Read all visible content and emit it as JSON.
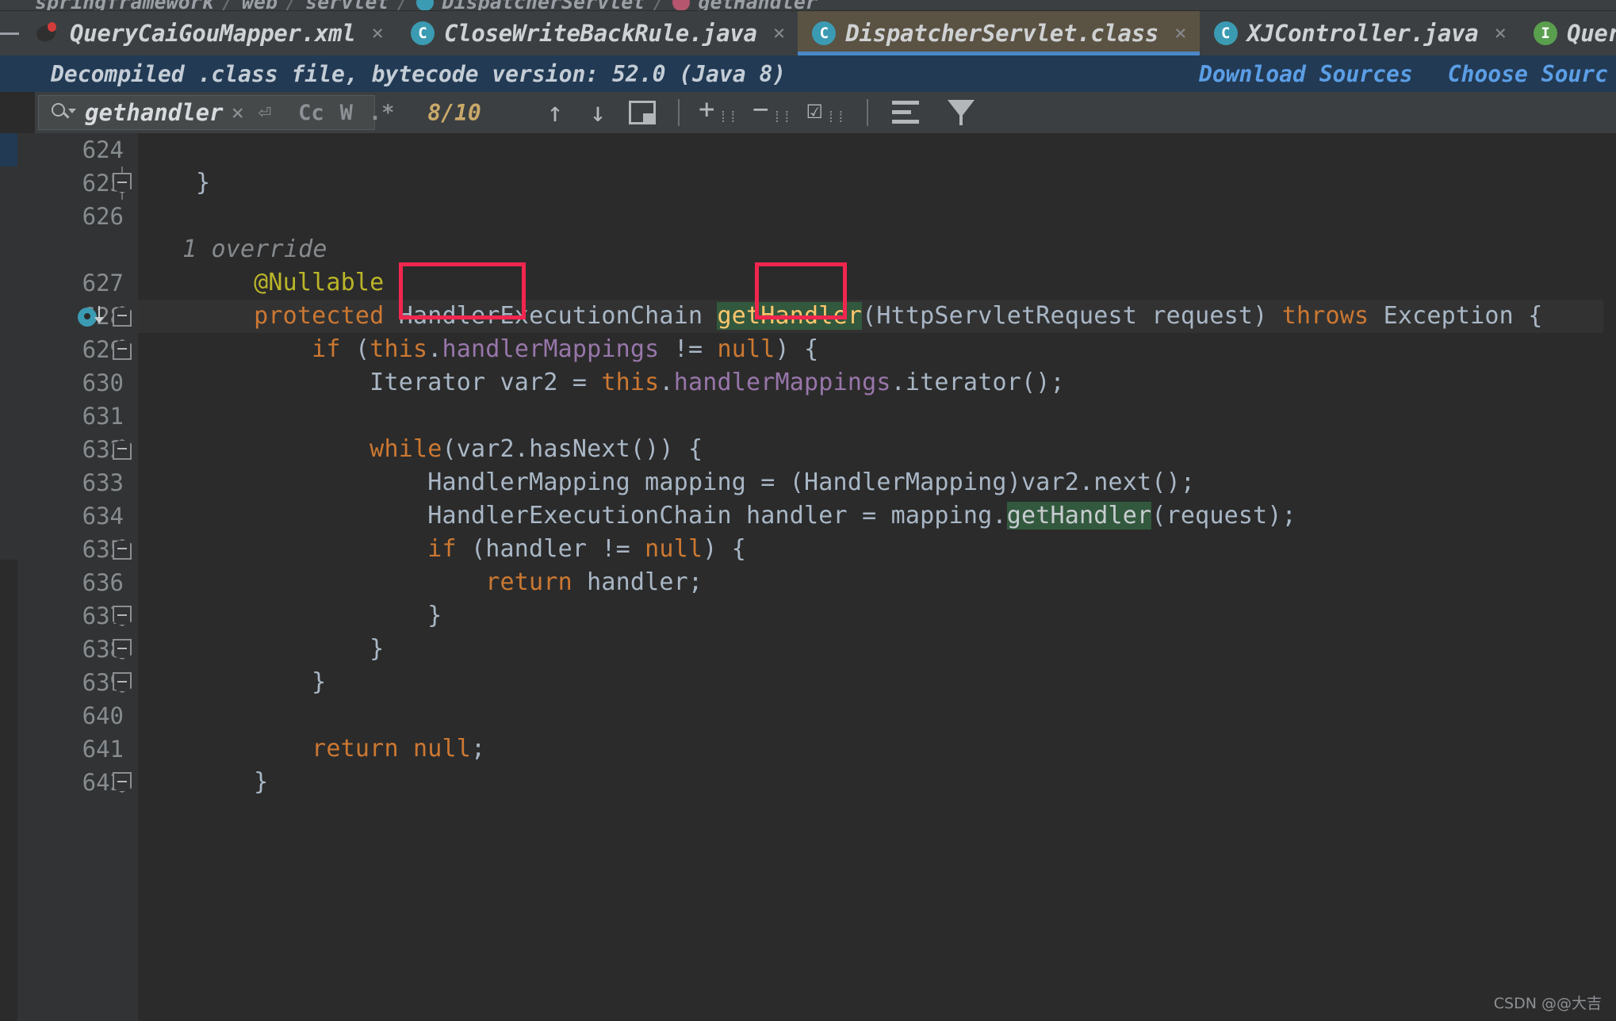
{
  "breadcrumb": {
    "items": [
      {
        "label": "springframework",
        "icon": ""
      },
      {
        "label": "web",
        "icon": ""
      },
      {
        "label": "servlet",
        "icon": ""
      },
      {
        "label": "DispatcherServlet",
        "icon": "class-icon"
      },
      {
        "label": "getHandler",
        "icon": "method-icon"
      }
    ],
    "separator": "/"
  },
  "tabs": {
    "minimize_label": "—",
    "close_label": "×",
    "items": [
      {
        "label": "QueryCaiGouMapper.xml",
        "icon": "xml-file-icon",
        "icon_letter": "",
        "active": false
      },
      {
        "label": "CloseWriteBackRule.java",
        "icon": "class-icon",
        "icon_letter": "C",
        "active": false
      },
      {
        "label": "DispatcherServlet.class",
        "icon": "class-icon",
        "icon_letter": "C",
        "active": true
      },
      {
        "label": "XJController.java",
        "icon": "class-icon",
        "icon_letter": "C",
        "active": false
      },
      {
        "label": "QueryC",
        "icon": "interface-icon",
        "icon_letter": "I",
        "active": false
      }
    ]
  },
  "notification": {
    "message": "Decompiled .class file, bytecode version: 52.0 (Java 8)",
    "download_sources": "Download Sources",
    "choose_sources": "Choose Sourc",
    "background_color": "#223a54",
    "link_color": "#5b9ee6"
  },
  "find": {
    "query": "gethandler",
    "clear_label": "×",
    "newline_label": "⏎",
    "match_case_label": "Cc",
    "words_label": "W",
    "regex_label": ".*",
    "match_count": "8/10",
    "prev_label": "↑",
    "next_label": "↓",
    "select_in_editor_label": "select-in-editor",
    "add_occurrence_label": "+",
    "remove_occurrence_label": "−",
    "select_all_occurrences_label": "☑",
    "filter_lines_label": "filter-lines",
    "filter_label": "filter"
  },
  "editor": {
    "highlight_color": "#32593d",
    "annotation_color": "#f0264e",
    "current_line_color": "#323232",
    "gutter_hint": "1 override",
    "lines": [
      {
        "number": "624",
        "text": "",
        "fold": "none"
      },
      {
        "number": "625",
        "text": "    }",
        "fold": "bottom"
      },
      {
        "number": "626",
        "text": "",
        "fold": "line"
      },
      {
        "number": "",
        "text": "        1 override",
        "fold": "line"
      },
      {
        "number": "627",
        "text": "        @Nullable",
        "fold": "line"
      },
      {
        "number": "628",
        "text": "        protected HandlerExecutionChain getHandler(HttpServletRequest request) throws Exception {",
        "fold": "top"
      },
      {
        "number": "629",
        "text": "            if (this.handlerMappings != null) {",
        "fold": "top"
      },
      {
        "number": "630",
        "text": "                Iterator var2 = this.handlerMappings.iterator();",
        "fold": "line"
      },
      {
        "number": "631",
        "text": "",
        "fold": "line"
      },
      {
        "number": "632",
        "text": "                while(var2.hasNext()) {",
        "fold": "top"
      },
      {
        "number": "633",
        "text": "                    HandlerMapping mapping = (HandlerMapping)var2.next();",
        "fold": "line"
      },
      {
        "number": "634",
        "text": "                    HandlerExecutionChain handler = mapping.getHandler(request);",
        "fold": "line"
      },
      {
        "number": "635",
        "text": "                    if (handler != null) {",
        "fold": "top"
      },
      {
        "number": "636",
        "text": "                        return handler;",
        "fold": "line"
      },
      {
        "number": "637",
        "text": "                    }",
        "fold": "bottom"
      },
      {
        "number": "638",
        "text": "                }",
        "fold": "bottom"
      },
      {
        "number": "639",
        "text": "            }",
        "fold": "bottom"
      },
      {
        "number": "640",
        "text": "",
        "fold": "line"
      },
      {
        "number": "641",
        "text": "            return null;",
        "fold": "line"
      },
      {
        "number": "642",
        "text": "        }",
        "fold": "bottom"
      }
    ]
  },
  "watermark": "CSDN @@大吉"
}
